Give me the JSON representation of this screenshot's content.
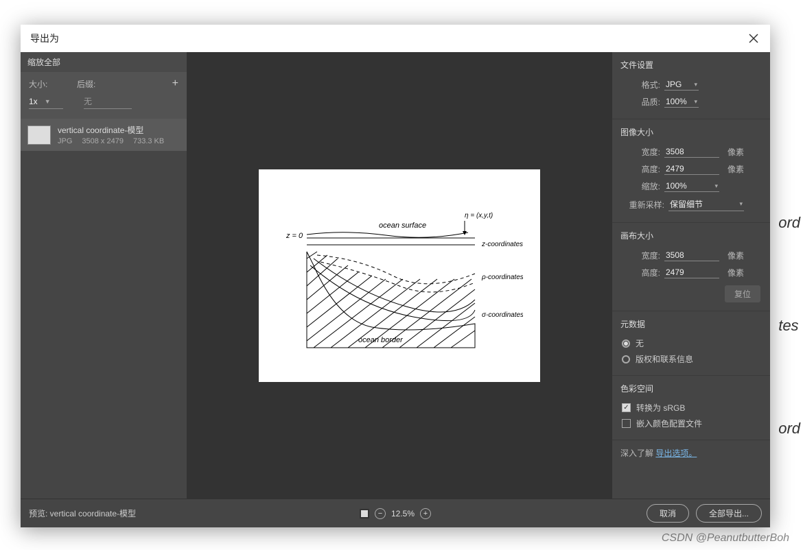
{
  "background_fragments": [
    "ord",
    "tes",
    "ord"
  ],
  "watermark": "CSDN @PeanutbutterBoh",
  "dialog": {
    "title": "导出为",
    "scale_all": {
      "header": "缩放全部",
      "size_label": "大小:",
      "suffix_label": "后缀:",
      "size_value": "1x",
      "suffix_placeholder": "无"
    },
    "asset": {
      "name": "vertical coordinate-模型",
      "format": "JPG",
      "dimensions": "3508 x 2479",
      "filesize": "733.3 KB"
    },
    "file_settings": {
      "title": "文件设置",
      "format_label": "格式:",
      "format_value": "JPG",
      "quality_label": "品质:",
      "quality_value": "100%"
    },
    "image_size": {
      "title": "图像大小",
      "width_label": "宽度:",
      "width_value": "3508",
      "height_label": "高度:",
      "height_value": "2479",
      "scale_label": "缩放:",
      "scale_value": "100%",
      "resample_label": "重新采样:",
      "resample_value": "保留细节",
      "unit": "像素"
    },
    "canvas_size": {
      "title": "画布大小",
      "width_label": "宽度:",
      "width_value": "3508",
      "height_label": "高度:",
      "height_value": "2479",
      "unit": "像素",
      "reset": "复位"
    },
    "metadata": {
      "title": "元数据",
      "none": "无",
      "copyright": "版权和联系信息"
    },
    "color_space": {
      "title": "色彩空间",
      "srgb": "转换为 sRGB",
      "embed": "嵌入颜色配置文件"
    },
    "learn_more": {
      "prefix": "深入了解 ",
      "link": "导出选项。"
    },
    "footer": {
      "preview_prefix": "预览: ",
      "preview_name": "vertical coordinate-模型",
      "zoom": "12.5%",
      "cancel": "取消",
      "export_all": "全部导出..."
    },
    "diagram": {
      "eta": "η = (x,y,t)",
      "z0": "z = 0",
      "surface": "ocean surface",
      "zcoord": "z-coordinates",
      "pcoord": "ρ-coordinates",
      "scoord": "σ-coordinates",
      "border": "ocean border"
    }
  }
}
